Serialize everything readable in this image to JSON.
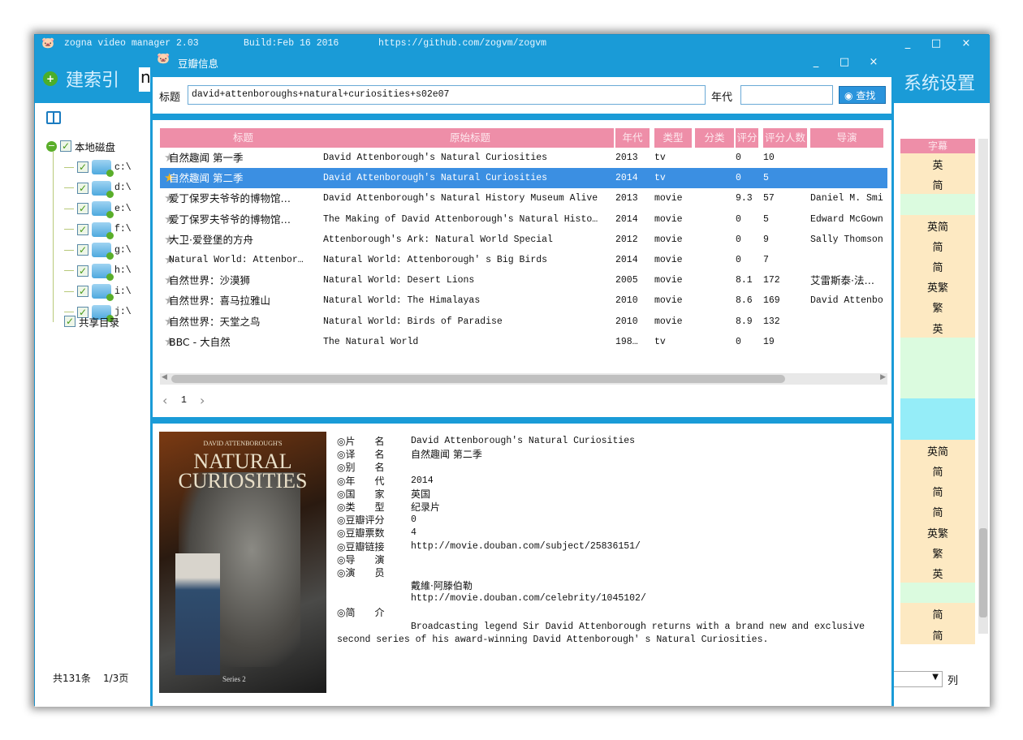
{
  "main_window": {
    "title": "zogna video manager 2.03",
    "build": "Build:Feb 16 2016",
    "url": "https://github.com/zogvm/zogvm",
    "build_index_button": "建索引",
    "search_partial": "n",
    "settings_button": "系统设置",
    "window_controls": [
      "_",
      "□",
      "×"
    ]
  },
  "sidebar": {
    "root": "本地磁盘",
    "drives": [
      "c:\\",
      "d:\\",
      "e:\\",
      "f:\\",
      "g:\\",
      "h:\\",
      "i:\\",
      "j:\\"
    ],
    "shared": "共享目录",
    "footer_count": "共131条",
    "footer_page": "1/3页"
  },
  "right_column": {
    "header": "字幕",
    "cells": [
      {
        "v": "英",
        "b": "o"
      },
      {
        "v": "简",
        "b": "o"
      },
      {
        "v": "",
        "b": "g"
      },
      {
        "v": "英简",
        "b": "o"
      },
      {
        "v": "简",
        "b": "o"
      },
      {
        "v": "简",
        "b": "o"
      },
      {
        "v": "英繁",
        "b": "o"
      },
      {
        "v": "繁",
        "b": "o"
      },
      {
        "v": "英",
        "b": "o"
      },
      {
        "v": "",
        "b": "g"
      },
      {
        "v": "",
        "b": "g"
      },
      {
        "v": "",
        "b": "g"
      },
      {
        "v": "",
        "b": "c"
      },
      {
        "v": "",
        "b": "c"
      },
      {
        "v": "英简",
        "b": "o"
      },
      {
        "v": "简",
        "b": "o"
      },
      {
        "v": "简",
        "b": "o"
      },
      {
        "v": "简",
        "b": "o"
      },
      {
        "v": "英繁",
        "b": "o"
      },
      {
        "v": "繁",
        "b": "o"
      },
      {
        "v": "英",
        "b": "o"
      },
      {
        "v": "",
        "b": "g"
      },
      {
        "v": "简",
        "b": "o"
      },
      {
        "v": "简",
        "b": "o"
      }
    ],
    "columns_label": "列"
  },
  "dialog": {
    "title": "豆瓣信息",
    "title_label": "标题",
    "title_value": "david+attenboroughs+natural+curiosities+s02e07",
    "year_label": "年代",
    "year_value": "",
    "search_button": "查找",
    "columns": [
      "标题",
      "原始标题",
      "年代",
      "类型",
      "分类",
      "评分",
      "评分人数",
      "导演"
    ],
    "rows": [
      [
        "自然趣闻 第一季",
        "David Attenborough's Natural Curiosities",
        "2013",
        "tv",
        "",
        "0",
        "10",
        ""
      ],
      [
        "自然趣闻 第二季",
        "David Attenborough's Natural Curiosities",
        "2014",
        "tv",
        "",
        "0",
        "5",
        ""
      ],
      [
        "爱丁保罗夫爷爷的博物馆…",
        "David Attenborough's Natural History Museum Alive",
        "2013",
        "movie",
        "",
        "9.3",
        "57",
        "Daniel M. Smi"
      ],
      [
        "爱丁保罗夫爷爷的博物馆…",
        "The Making of David Attenborough's Natural Histo…",
        "2014",
        "movie",
        "",
        "0",
        "5",
        "Edward McGown"
      ],
      [
        "大卫·爱登堡的方舟",
        "Attenborough's Ark: Natural World Special",
        "2012",
        "movie",
        "",
        "0",
        "9",
        "Sally Thomson"
      ],
      [
        "Natural World: Attenbor…",
        "Natural World: Attenborough' s Big Birds",
        "2014",
        "movie",
        "",
        "0",
        "7",
        ""
      ],
      [
        "自然世界：沙漠狮",
        "Natural World: Desert Lions",
        "2005",
        "movie",
        "",
        "8.1",
        "172",
        "艾雷斯泰·法…"
      ],
      [
        "自然世界：喜马拉雅山",
        "Natural World: The Himalayas",
        "2010",
        "movie",
        "",
        "8.6",
        "169",
        "David Attenbo"
      ],
      [
        "自然世界：天堂之鸟",
        "Natural World: Birds of Paradise",
        "2010",
        "movie",
        "",
        "8.9",
        "132",
        ""
      ],
      [
        "BBC - 大自然",
        "The Natural World",
        "198…",
        "tv",
        "",
        "0",
        "19",
        ""
      ]
    ],
    "selected_row": 1,
    "page": "1",
    "detail": {
      "poster": {
        "top": "DAVID ATTENBOROUGH'S",
        "title1": "NATURAL",
        "title2": "CURIOSITIES",
        "series": "Series 2"
      },
      "fields": [
        {
          "label": "◎片　　名",
          "value": "David Attenborough's Natural Curiosities"
        },
        {
          "label": "◎译　　名",
          "value": "自然趣闻 第二季"
        },
        {
          "label": "◎别　　名",
          "value": ""
        },
        {
          "label": "◎年　　代",
          "value": "2014"
        },
        {
          "label": "◎国　　家",
          "value": "英国"
        },
        {
          "label": "◎类　　型",
          "value": "纪录片"
        },
        {
          "label": "◎豆瓣评分",
          "value": "0"
        },
        {
          "label": "◎豆瓣票数",
          "value": "4"
        },
        {
          "label": "◎豆瓣链接",
          "value": "http://movie.douban.com/subject/25836151/"
        },
        {
          "label": "◎导　　演",
          "value": ""
        },
        {
          "label": "◎演　　员",
          "value": ""
        },
        {
          "label": "",
          "value": "戴維·阿滕伯勒"
        },
        {
          "label": "",
          "value": "http://movie.douban.com/celebrity/1045102/"
        },
        {
          "label": "◎简　　介",
          "value": ""
        }
      ],
      "summary_line1": "Broadcasting legend Sir David Attenborough returns with a brand new and exclusive",
      "summary_line2": "second series of his award-winning David Attenborough' s Natural Curiosities."
    }
  },
  "colors": {
    "blue": "#1a9bd7",
    "header_pink": "#ee8ea8",
    "selected": "#3b8fe2",
    "orange": "#fde9c2",
    "green": "#dbfbdf",
    "cyan": "#95edf8"
  }
}
